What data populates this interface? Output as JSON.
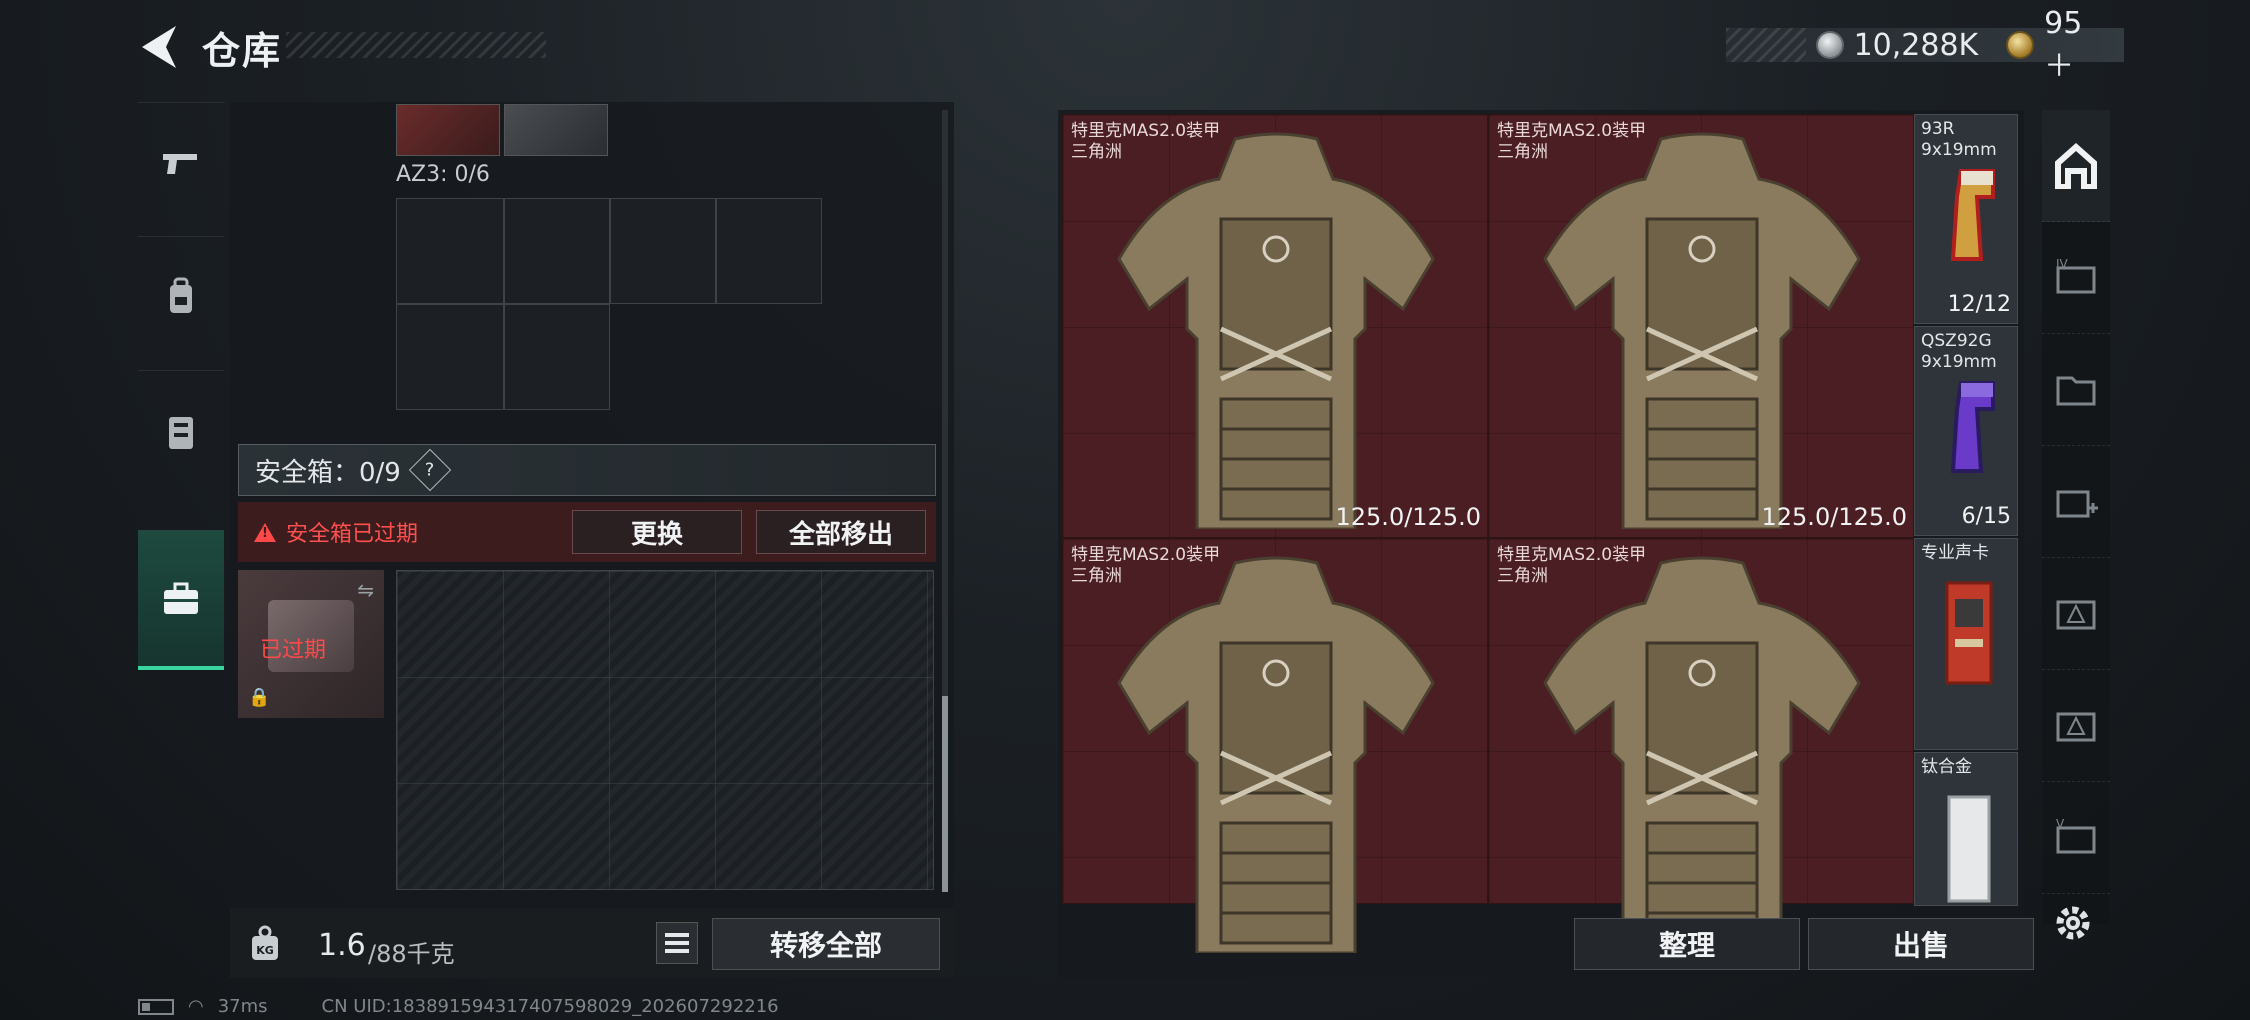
{
  "header": {
    "title": "仓库",
    "currency_primary": "10,288K",
    "currency_secondary": "95＋"
  },
  "category_tabs": [
    "weapon-tab",
    "backpack-tab",
    "chest-rig-tab",
    "safe-box-tab"
  ],
  "warehouse": {
    "container_label": "AZ3: 0/6",
    "safe_box": {
      "label": "安全箱：0/9",
      "help": "?",
      "expired_warning": "安全箱已过期",
      "replace_button": "更换",
      "move_all_out_button": "全部移出",
      "slot_overlay": "已过期"
    },
    "weight_value": "1.6",
    "weight_capacity": "/88千克",
    "transfer_all_button": "转移全部"
  },
  "storage": {
    "armor_items": [
      {
        "name": "特里克MAS2.0装甲",
        "sub": "三角洲",
        "durability": "125.0/125.0"
      },
      {
        "name": "特里克MAS2.0装甲",
        "sub": "三角洲",
        "durability": "125.0/125.0"
      },
      {
        "name": "特里克MAS2.0装甲",
        "sub": "三角洲",
        "durability": ""
      },
      {
        "name": "特里克MAS2.0装甲",
        "sub": "三角洲",
        "durability": ""
      }
    ],
    "side_items": [
      {
        "name": "93R",
        "sub": "9x19mm",
        "count": "12/12"
      },
      {
        "name": "QSZ92G",
        "sub": "9x19mm",
        "count": "6/15"
      },
      {
        "name": "专业声卡",
        "sub": "",
        "count": ""
      },
      {
        "name": "钛合金",
        "sub": "",
        "count": ""
      }
    ],
    "organize_button": "整理",
    "sell_button": "出售"
  },
  "status_bar": {
    "ping": "37ms",
    "uid": "CN UID:1838915943174075980​29_202607292216"
  },
  "colors": {
    "accent_green": "#3ad6a0",
    "expired_red": "#ff4848",
    "armor_cell_bg": "#4a1e22"
  }
}
